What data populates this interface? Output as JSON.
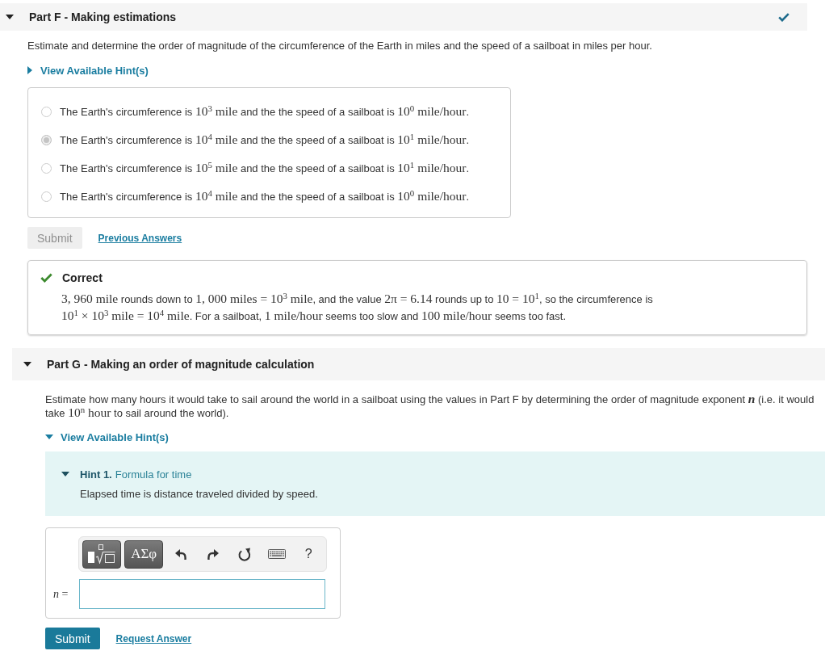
{
  "parts": [
    {
      "kind": "choice",
      "title": "Part F - Making estimations",
      "expanded": true,
      "completed": true,
      "prompt": [
        {
          "kind": "text",
          "text": "Estimate and determine the order of magnitude of the circumference of the Earth in miles and the speed of a sailboat in miles per hour."
        }
      ],
      "hints_toggle": {
        "label": "View Available Hint(s)",
        "expanded": false
      },
      "options": [
        {
          "selected": false,
          "segments": [
            {
              "kind": "text",
              "text": "The Earth's circumference is "
            },
            {
              "kind": "math",
              "text": "10$^{3}$ mile"
            },
            {
              "kind": "text",
              "text": " and the the speed of a sailboat is "
            },
            {
              "kind": "math",
              "text": "10$^{0}$ mile/hour"
            },
            {
              "kind": "text",
              "text": "."
            }
          ]
        },
        {
          "selected": true,
          "segments": [
            {
              "kind": "text",
              "text": "The Earth's circumference is "
            },
            {
              "kind": "math",
              "text": "10$^{4}$ mile"
            },
            {
              "kind": "text",
              "text": " and the the speed of a sailboat is "
            },
            {
              "kind": "math",
              "text": "10$^{1}$ mile/hour"
            },
            {
              "kind": "text",
              "text": "."
            }
          ]
        },
        {
          "selected": false,
          "segments": [
            {
              "kind": "text",
              "text": "The Earth's circumference is "
            },
            {
              "kind": "math",
              "text": "10$^{5}$ mile"
            },
            {
              "kind": "text",
              "text": " and the the speed of a sailboat is "
            },
            {
              "kind": "math",
              "text": "10$^{1}$ mile/hour"
            },
            {
              "kind": "text",
              "text": "."
            }
          ]
        },
        {
          "selected": false,
          "segments": [
            {
              "kind": "text",
              "text": "The Earth's circumference is "
            },
            {
              "kind": "math",
              "text": "10$^{4}$ mile"
            },
            {
              "kind": "text",
              "text": " and the the speed of a sailboat is "
            },
            {
              "kind": "math",
              "text": "10$^{0}$ mile/hour"
            },
            {
              "kind": "text",
              "text": "."
            }
          ]
        }
      ],
      "actions": {
        "submit": {
          "label": "Submit",
          "disabled": true
        },
        "link": "Previous Answers"
      },
      "feedback": {
        "kind": "correct",
        "title": "Correct",
        "body": [
          {
            "kind": "math",
            "text": "3, 960 mile"
          },
          {
            "kind": "text",
            "text": " rounds down to "
          },
          {
            "kind": "math",
            "text": "1, 000 miles = 10$^{3}$ mile"
          },
          {
            "kind": "text",
            "text": ", and the value "
          },
          {
            "kind": "math",
            "text": "2π = 6.14"
          },
          {
            "kind": "text",
            "text": " rounds up to "
          },
          {
            "kind": "math",
            "text": "10 = 10$^{1}$"
          },
          {
            "kind": "text",
            "text": ", so the circumference is "
          },
          {
            "kind": "math",
            "text": "10$^{1}$ × 10$^{3}$ mile = 10$^{4}$ mile"
          },
          {
            "kind": "text",
            "text": ". For a sailboat, "
          },
          {
            "kind": "math",
            "text": "1 mile/hour"
          },
          {
            "kind": "text",
            "text": " seems too slow and "
          },
          {
            "kind": "math",
            "text": "100 mile/hour"
          },
          {
            "kind": "text",
            "text": " seems too fast."
          }
        ]
      }
    },
    {
      "kind": "numeric",
      "title": "Part G - Making an order of magnitude calculation",
      "expanded": true,
      "completed": false,
      "prompt": [
        {
          "kind": "text",
          "text": "Estimate how many hours it would take to sail around the world in a sailboat using the values in Part F by determining the order of magnitude exponent "
        },
        {
          "kind": "var",
          "text": "n"
        },
        {
          "kind": "text",
          "text": " (i.e. it would take "
        },
        {
          "kind": "math",
          "text": "10$^{n}$ hour"
        },
        {
          "kind": "text",
          "text": " to sail around the world)."
        }
      ],
      "hints_toggle": {
        "label": "View Available Hint(s)",
        "expanded": true
      },
      "hints": [
        {
          "number": "Hint 1.",
          "title": "Formula for time",
          "expanded": true,
          "text": "Elapsed time is distance traveled divided by speed."
        }
      ],
      "answer": {
        "toolbar": [
          {
            "kind": "templates"
          },
          {
            "kind": "symbols",
            "label": "ΑΣφ"
          },
          {
            "kind": "undo"
          },
          {
            "kind": "redo"
          },
          {
            "kind": "reset"
          },
          {
            "kind": "keyboard"
          },
          {
            "kind": "help",
            "label": "?"
          }
        ],
        "variable": "*n* ="
      },
      "actions": {
        "submit": {
          "label": "Submit",
          "disabled": false
        },
        "link": "Request Answer"
      }
    }
  ]
}
